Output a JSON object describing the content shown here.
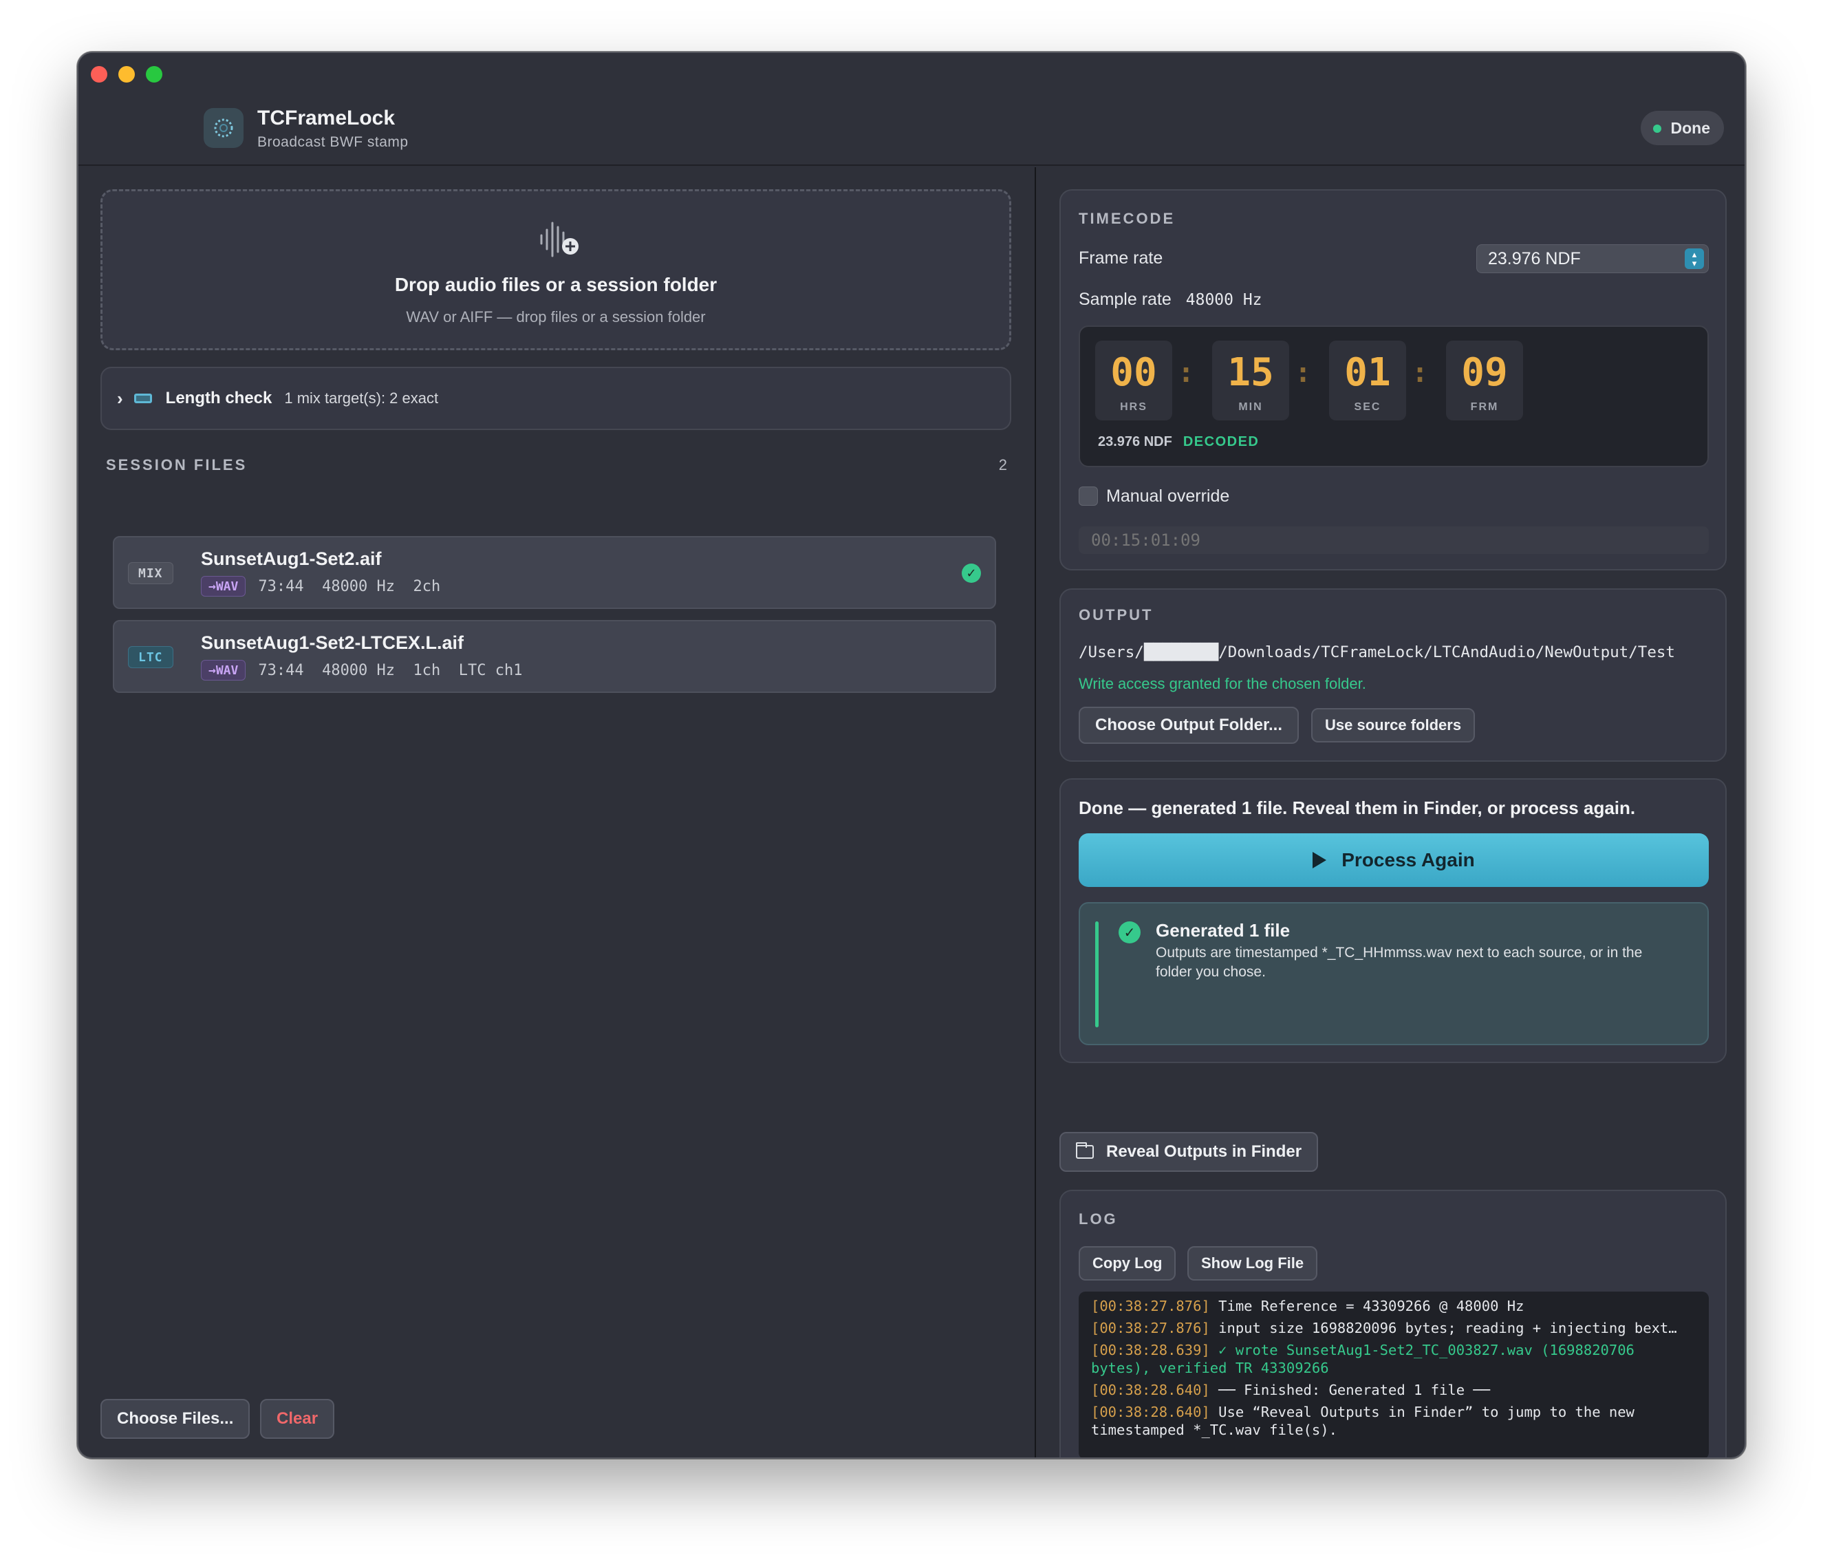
{
  "app": {
    "title": "TCFrameLock",
    "subtitle": "Broadcast BWF stamp",
    "status": "Done",
    "status_color": "#36c98c"
  },
  "dropzone": {
    "title": "Drop audio files or a session folder",
    "subtitle": "WAV or AIFF — drop files or a session folder",
    "icon": "audio-add-icon"
  },
  "length_check": {
    "label": "Length check",
    "detail": "1 mix target(s): 2 exact"
  },
  "session": {
    "header": "SESSION FILES",
    "count": "2",
    "files": [
      {
        "kind": "MIX",
        "name": "SunsetAug1-Set2.aif",
        "convert": "→WAV",
        "meta": "73:44  48000 Hz  2ch",
        "status": "ok"
      },
      {
        "kind": "LTC",
        "name": "SunsetAug1-Set2-LTCEX.L.aif",
        "convert": "→WAV",
        "meta": "73:44  48000 Hz  1ch  LTC ch1"
      }
    ]
  },
  "left_buttons": {
    "choose_files": "Choose Files...",
    "clear": "Clear"
  },
  "timecode": {
    "title": "TIMECODE",
    "frame_rate_label": "Frame rate",
    "frame_rate_value": "23.976 NDF",
    "sample_rate_label": "Sample rate",
    "sample_rate_value": "48000 Hz",
    "hrs": "00",
    "min": "15",
    "sec": "01",
    "frm": "09",
    "units": {
      "hrs": "HRS",
      "min": "MIN",
      "sec": "SEC",
      "frm": "FRM"
    },
    "rate_readout": "23.976 NDF",
    "decode_status": "DECODED",
    "manual_override_label": "Manual override",
    "manual_override_checked": false,
    "manual_placeholder": "00:15:01:09",
    "digit_color": "#f0b34a"
  },
  "output": {
    "title": "OUTPUT",
    "path": "/Users/████████/Downloads/TCFrameLock/LTCAndAudio/NewOutput/Test",
    "access_message": "Write access granted for the chosen folder.",
    "choose_folder_label": "Choose Output Folder...",
    "use_source_label": "Use source folders"
  },
  "result": {
    "message": "Done — generated 1 file. Reveal them in Finder, or process again.",
    "process_again_label": "Process Again",
    "generated_title": "Generated 1 file",
    "generated_desc": "Outputs are timestamped *_TC_HHmmss.wav next to each source, or in the folder you chose.",
    "accent_color": "#4db8d4"
  },
  "reveal_label": "Reveal Outputs in Finder",
  "log": {
    "title": "LOG",
    "copy_label": "Copy Log",
    "show_file_label": "Show Log File",
    "lines": [
      {
        "ts": "[00:38:27.876]",
        "text": "  Time Reference = 43309266 @ 48000 Hz",
        "ok": false
      },
      {
        "ts": "[00:38:27.876]",
        "text": "  input size 1698820096 bytes; reading + injecting bext…",
        "ok": false
      },
      {
        "ts": "[00:38:28.639]",
        "text": "  ✓ wrote SunsetAug1-Set2_TC_003827.wav (1698820706 bytes), verified TR 43309266",
        "ok": true
      },
      {
        "ts": "[00:38:28.640]",
        "text": " ── Finished: Generated 1 file ──",
        "ok": false
      },
      {
        "ts": "[00:38:28.640]",
        "text": " Use “Reveal Outputs in Finder” to jump to the new timestamped *_TC.wav file(s).",
        "ok": false
      }
    ]
  }
}
